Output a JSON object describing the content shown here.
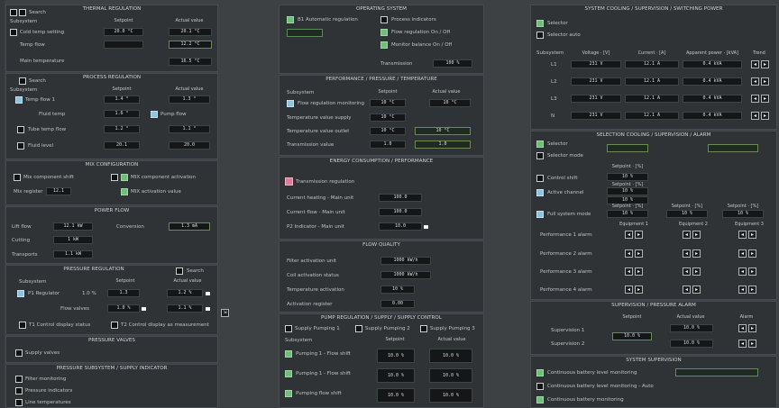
{
  "thermal_reg": {
    "title": "THERMAL REGULATION",
    "search_label": "Search",
    "sub_header": "Subsystem",
    "col_setpoint": "Setpoint",
    "col_actual": "Actual value",
    "row1_label": "Cold temp setting",
    "row1_set": "20.0 °C",
    "row1_act": "20.1 °C",
    "row2_label": "Temp flow",
    "row2_act": "12.2 °C",
    "row3_label": "Main temperature",
    "row3_act": "16.5 °C"
  },
  "process_reg": {
    "title": "PROCESS REGULATION",
    "search_label": "Search",
    "sub_header": "Subsystem",
    "col_setpoint": "Setpoint",
    "col_actual": "Actual value",
    "row1_label": "Temp flow 1",
    "row1_set": "1.4 °",
    "row1_act": "1.3 °",
    "row2_label": "Fluid temp",
    "row2_set": "1.6 °",
    "row2_extra": "Pump flow",
    "row3_label": "Tube temp flow",
    "row3_set": "1.2 °",
    "row3_act": "1.1 °",
    "row4_label": "Fluid level",
    "row4_set": "20.1",
    "row4_act": "20.0"
  },
  "mix_config": {
    "title": "MIX CONFIGURATION",
    "item1": "Mix component shift",
    "item2": "MIX component activation",
    "item3_label": "Mix register",
    "item3_val": "12.1",
    "item4": "MIX activation value"
  },
  "power_flow": {
    "title": "POWER FLOW",
    "row1_label": "Lift flow",
    "row1_val": "12.1 kW",
    "row1_extra_label": "Conversion",
    "row1_extra_val": "1.3 mA",
    "row2_label": "Cutting",
    "row2_val": "1 kW",
    "row3_label": "Transports",
    "row3_val": "1.1 kW"
  },
  "process_valve": {
    "title": "PRESSURE REGULATION",
    "search_label": "Search",
    "sub_header": "Subsystem",
    "col_setpoint": "Setpoint",
    "col_actual": "Actual value",
    "row1_label": "P1 Regulator",
    "row1_unit": "1.0 %",
    "row1_set": "1.3",
    "row1_act": "1.2 %",
    "row2_label": "Flow valves",
    "row2_set": "1.0 %",
    "row2_act": "1.1 %",
    "chk1": "T1 Control display status",
    "chk2": "T2 Control display as measurement"
  },
  "pressure_valves": {
    "title": "PRESSURE VALVES",
    "item1": "Supply valves"
  },
  "pressure_subsystem": {
    "title": "PRESSURE SUBSYSTEM / SUPPLY INDICATOR",
    "item1": "Filter monitoring",
    "item2": "Pressure indicators",
    "item3": "Line temperatures"
  },
  "operating_system": {
    "title": "OPERATING SYSTEM",
    "item1": "B1 Automatic regulation",
    "item2": "Process indicators",
    "item3": "Flow regulation On / Off",
    "item4": "Monitor balance On / Off",
    "item5_label": "Transmission",
    "item5_val": "100 %"
  },
  "performance": {
    "title": "PERFORMANCE / PRESSURE / TEMPERATURE",
    "sub_header": "Subsystem",
    "col_setpoint": "Setpoint",
    "col_actual": "Actual value",
    "row1_label": "Flow regulation monitoring",
    "row1_set": "10 °C",
    "row1_act": "10 °C",
    "row2_label": "Temperature value supply",
    "row2_set": "10 °C",
    "row3_label": "Temperature value outlet",
    "row3_set": "10 °C",
    "row3_act": "10 °C",
    "row4_label": "Transmission value",
    "row4_set": "1.0",
    "row4_act": "1.0"
  },
  "temperature_regulation": {
    "title": "ENERGY CONSUMPTION / PERFORMANCE",
    "item1": "Transmission regulation",
    "row1_label": "Current heating - Main unit",
    "row1_val": "100.0",
    "row2_label": "Current flow - Main unit",
    "row2_val": "100.0",
    "row3_label": "P2 Indicator - Main unit",
    "row3_val": "10.0"
  },
  "flow_quality": {
    "title": "FLOW QUALITY",
    "row1_label": "Filter activation unit",
    "row1_val": "1000 kW/h",
    "row2_label": "Coil activation status",
    "row2_val": "1000 kW/h",
    "row3_label": "Temperature activation",
    "row3_val": "10 %",
    "row4_label": "Activation register",
    "row4_val": "0.00"
  },
  "pump_regulation": {
    "title": "PUMP REGULATION / SUPPLY / SUPPLY CONTROL",
    "chk1": "Supply Pumping 1",
    "chk2": "Supply Pumping 2",
    "chk3": "Supply Pumping 3",
    "col_setpoint": "Setpoint",
    "col_actual": "Actual value",
    "sub_header": "Subsystem",
    "row1_label": "Pumping 1 - Flow shift",
    "row1_set": "10.0 %",
    "row1_act": "10.0 %",
    "row2_label": "Pumping 1 - Flow shift",
    "row2_set": "10.0 %",
    "row2_act": "10.0 %",
    "row3_label": "Pumping flow shift",
    "row3_set": "10.0 %",
    "row3_act": "10.0 %"
  },
  "system_cooling": {
    "title": "SYSTEM COOLING / SUPERVISION / SWITCHING POWER",
    "chk1": "Selector",
    "chk2": "Selector auto",
    "sub_header": "Subsystem",
    "col_voltage": "Voltage · [V]",
    "col_current": "Current · [A]",
    "col_power": "Apparent power · [kVA]",
    "col_trend": "Trend",
    "rows": [
      {
        "label": "L1",
        "v": "231 V",
        "a": "12.1 A",
        "p": "0.4 kVA"
      },
      {
        "label": "L2",
        "v": "231 V",
        "a": "12.1 A",
        "p": "0.4 kVA"
      },
      {
        "label": "L3",
        "v": "231 V",
        "a": "12.1 A",
        "p": "0.4 kVA"
      },
      {
        "label": "N",
        "v": "231 V",
        "a": "12.1 A",
        "p": "0.4 kVA"
      }
    ]
  },
  "selection_cooling": {
    "title": "SELECTION COOLING / SUPERVISION / ALARM",
    "chk1": "Selector",
    "chk2": "Selector mode",
    "row1_label": "Control shift",
    "row2_label": "Active channel",
    "row3_label": "Full system mode",
    "col_a": "Setpoint · [%]",
    "col_b": "Setpoint · [%]",
    "col_c": "Setpoint · [%]",
    "col_d": "Setpoint · [%]",
    "col_e": "Setpoint · [%]",
    "row1_val": "10 %",
    "row1_val2": "10 %",
    "row2_val": "10 %",
    "row3_val": "10 %",
    "row3_val2": "10 %",
    "row3_val3": "10 %",
    "subcol1": "Equipment 1",
    "subcol2": "Equipment 2",
    "subcol3": "Equipment 3",
    "prow1": "Performance 1 alarm",
    "prow2": "Performance 2 alarm",
    "prow3": "Performance 3 alarm",
    "prow4": "Performance 4 alarm"
  },
  "supervision_alarm": {
    "title": "SUPERVISION / PRESSURE ALARM",
    "col_setpoint": "Setpoint",
    "col_actual": "Actual value",
    "col_alarm": "Alarm",
    "row1_label": "Supervision 1",
    "row1_set": "10.0 %",
    "row1_act": "10.0 %",
    "row2_label": "Supervision 2",
    "row2_act": "10.0 %"
  },
  "system_supervision": {
    "title": "SYSTEM SUPERVISION",
    "chk1": "Continuous battery level monitoring",
    "chk2": "Continuous battery level monitoring - Auto",
    "chk3": "Continuous battery monitoring"
  },
  "colors": {
    "background": "#3d4144",
    "panel": "#2f3336",
    "accent_green": "#6fbf79",
    "accent_blue": "#8fc4e0",
    "accent_pink": "#e07a9a"
  }
}
